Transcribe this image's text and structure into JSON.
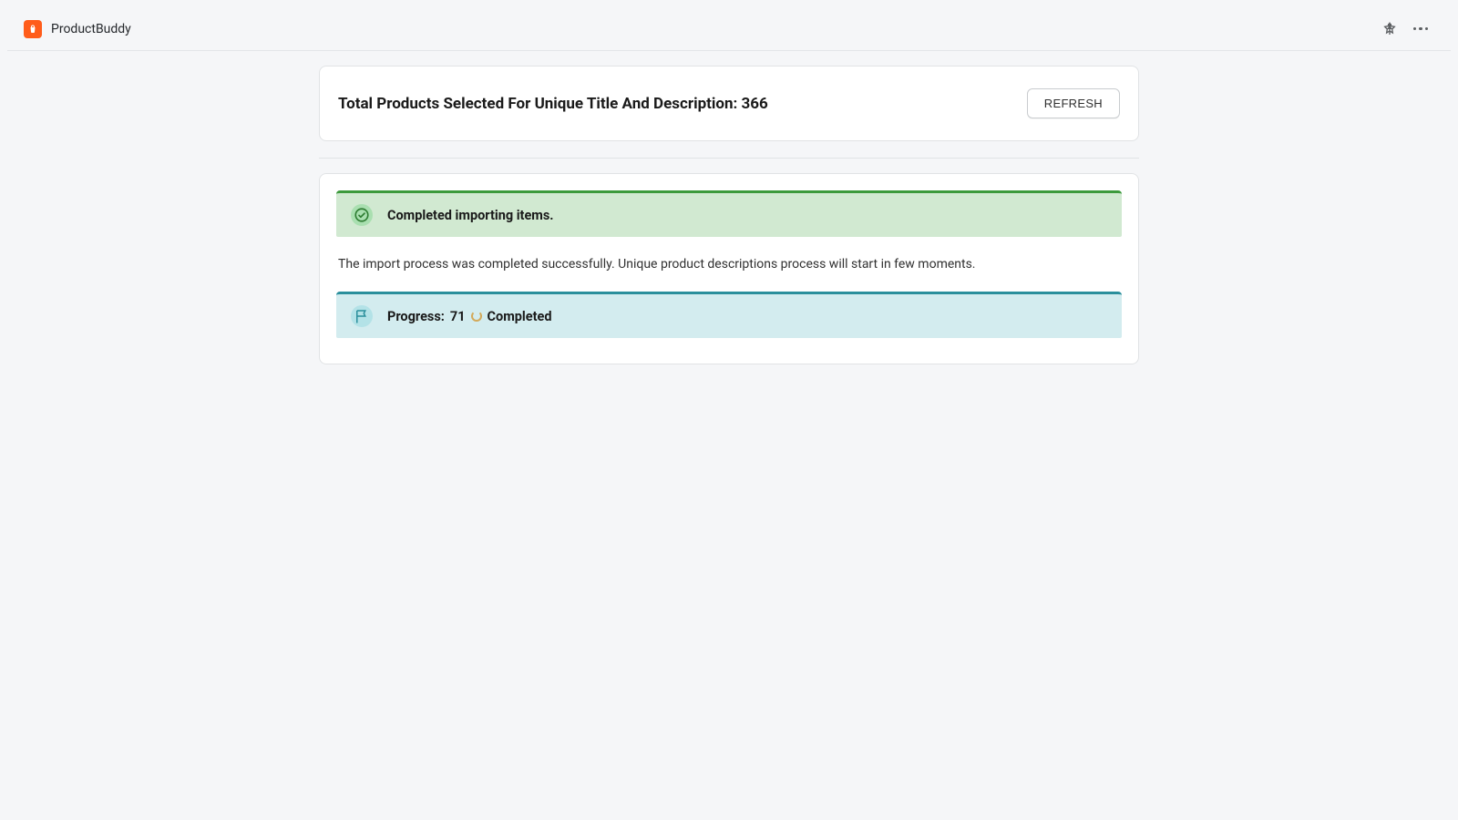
{
  "topbar": {
    "app_name": "ProductBuddy"
  },
  "header": {
    "title_prefix": "Total Products Selected For Unique Title And Description: ",
    "count": "366",
    "refresh_label": "REFRESH"
  },
  "status": {
    "success_message": "Completed importing items.",
    "info_line": "The import process was completed successfully. Unique product descriptions process will start in few moments.",
    "progress_prefix": "Progress: ",
    "progress_value": "71",
    "progress_suffix": " Completed"
  }
}
